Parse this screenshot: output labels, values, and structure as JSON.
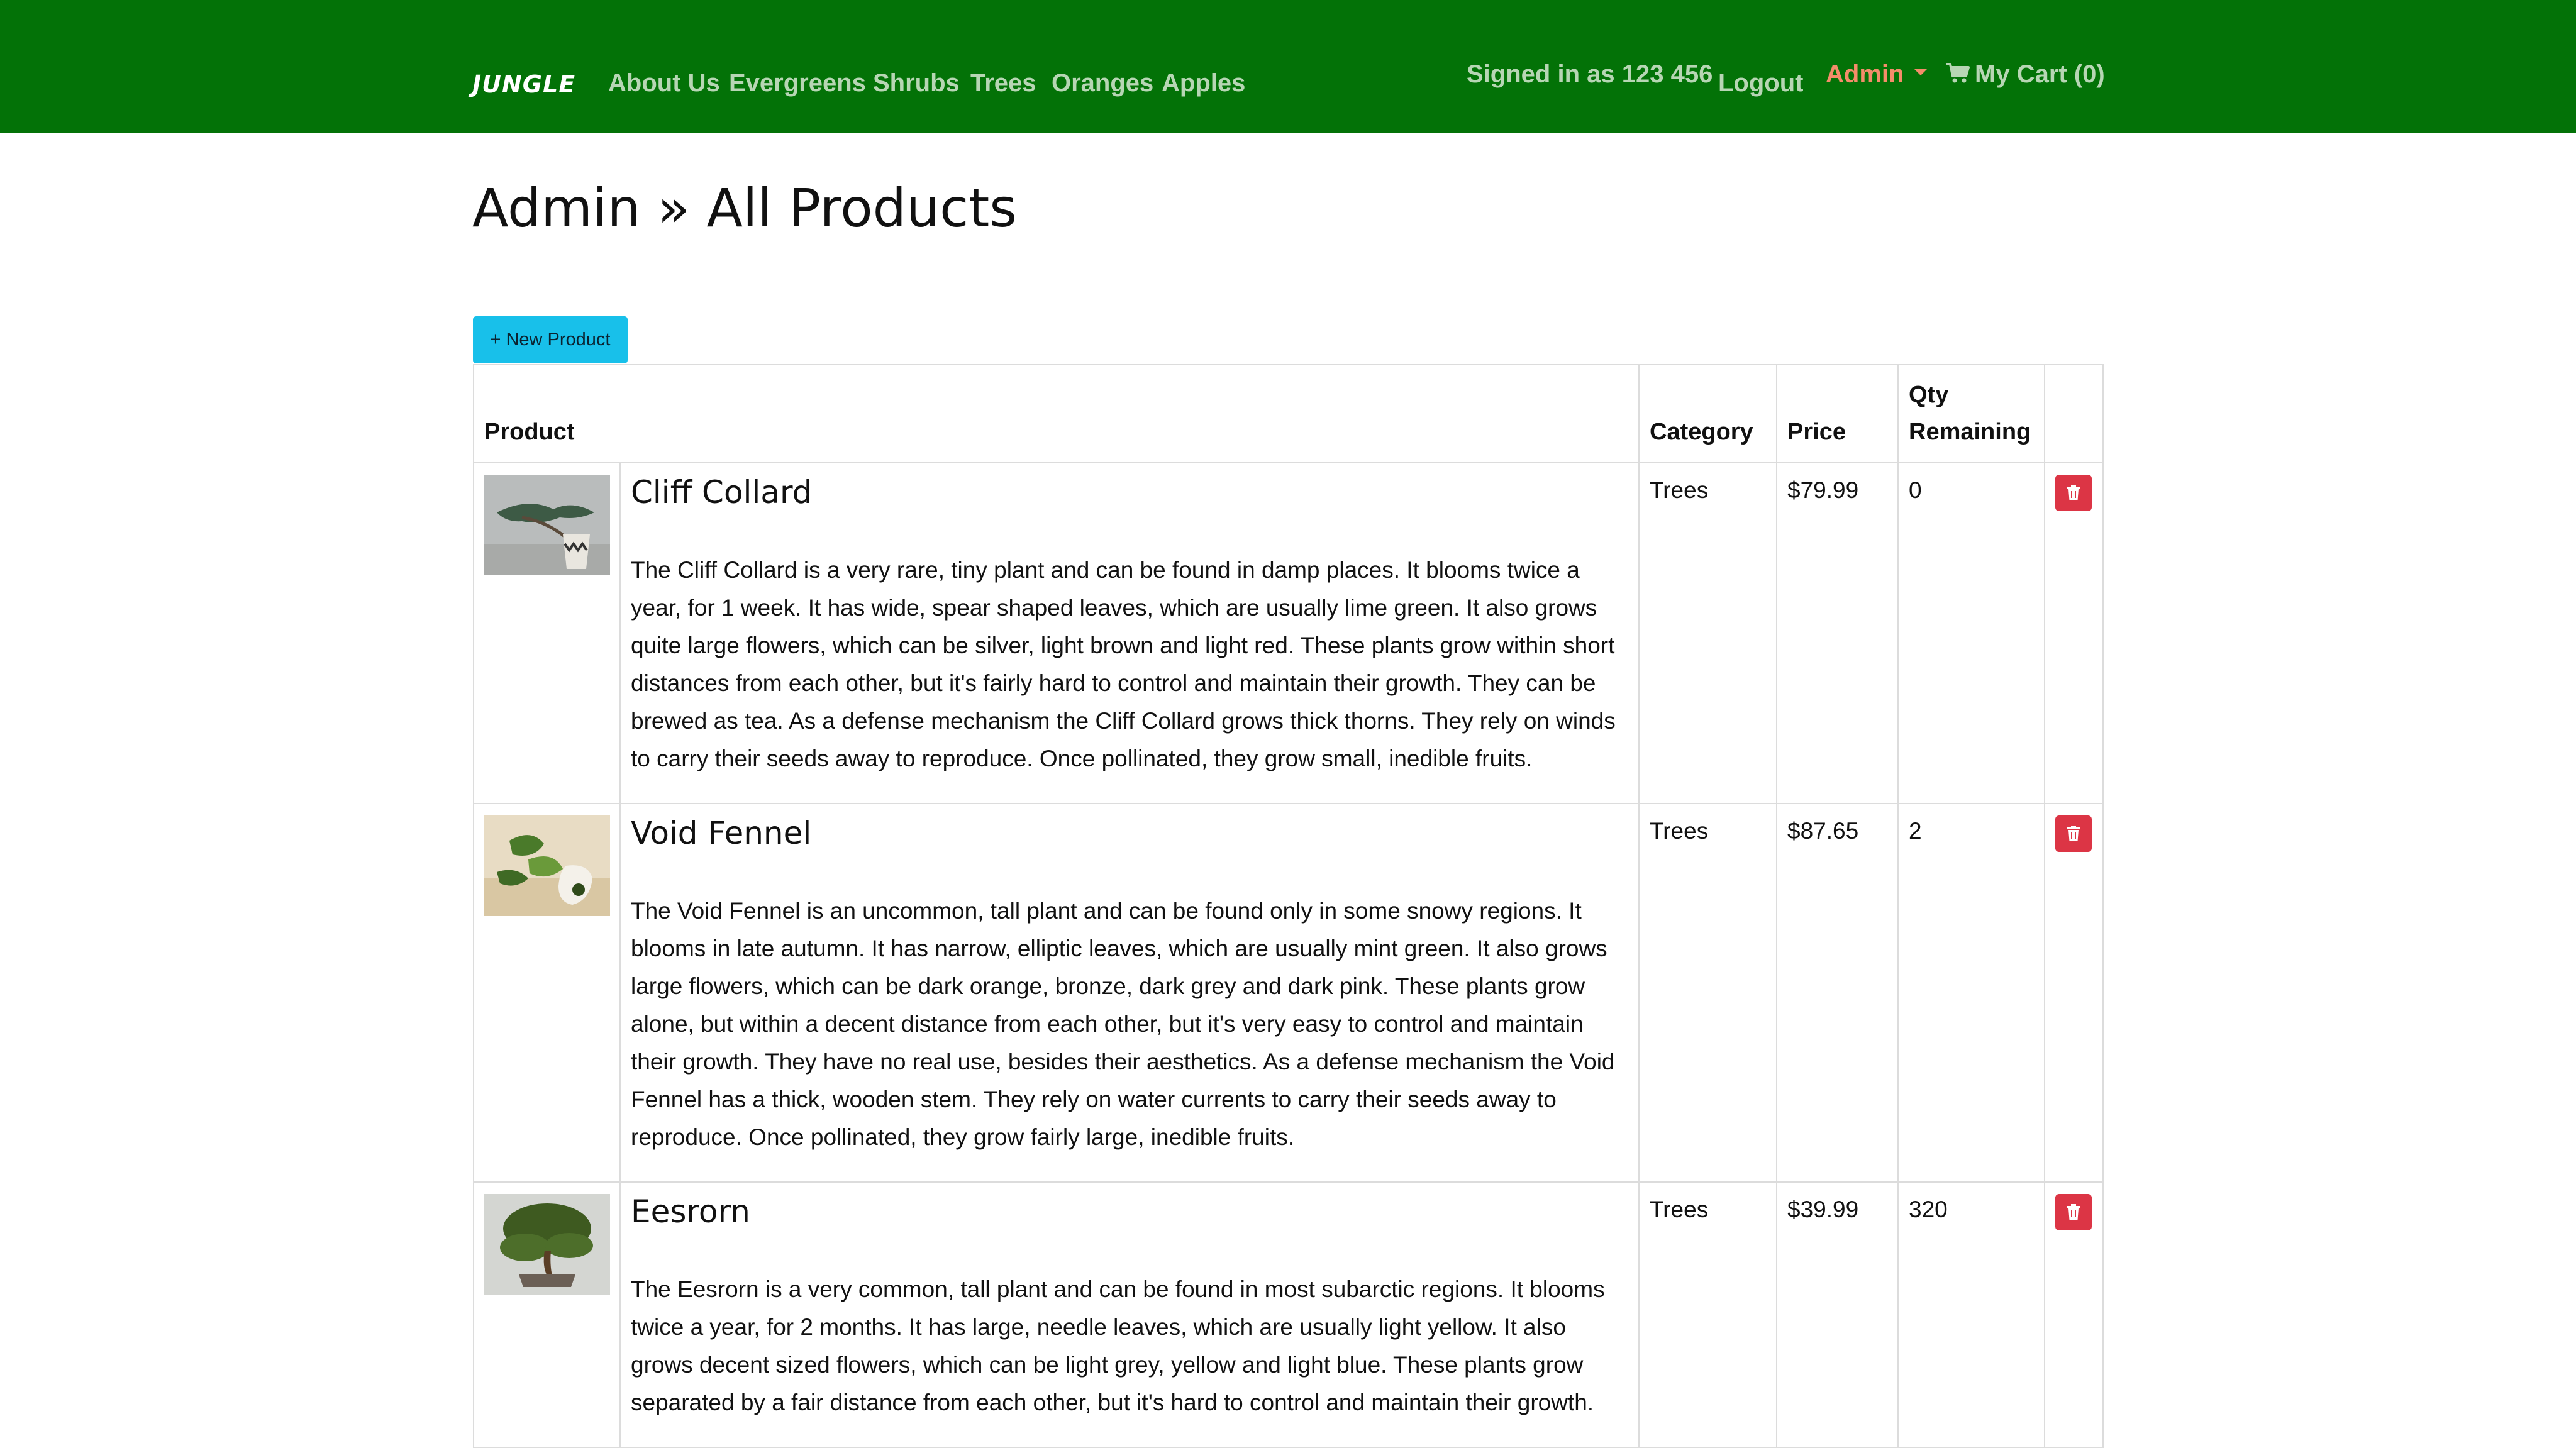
{
  "nav": {
    "brand": "JUNGLE",
    "links": [
      "About Us",
      "Evergreens",
      "Shrubs",
      "Trees",
      "Oranges",
      "Apples"
    ],
    "signed_in": "Signed in as 123 456",
    "logout": "Logout",
    "admin": "Admin",
    "cart": "My Cart (0)",
    "colors": {
      "bar": "#037207",
      "link": "#b7d6b4",
      "admin": "#f48d6a"
    }
  },
  "page": {
    "title": "Admin » All Products",
    "new_product_button": "+ New Product"
  },
  "table": {
    "headers": {
      "product": "Product",
      "category": "Category",
      "price": "Price",
      "qty": "Qty Remaining"
    },
    "rows": [
      {
        "name": "Cliff Collard",
        "description": "The Cliff Collard is a very rare, tiny plant and can be found in damp places. It blooms twice a year, for 1 week. It has wide, spear shaped leaves, which are usually lime green. It also grows quite large flowers, which can be silver, light brown and light red. These plants grow within short distances from each other, but it's fairly hard to control and maintain their growth. They can be brewed as tea. As a defense mechanism the Cliff Collard grows thick thorns. They rely on winds to carry their seeds away to reproduce. Once pollinated, they grow small, inedible fruits.",
        "category": "Trees",
        "price": "$79.99",
        "qty": "0",
        "image_icon": "bonsai-pine-photo"
      },
      {
        "name": "Void Fennel",
        "description": "The Void Fennel is an uncommon, tall plant and can be found only in some snowy regions. It blooms in late autumn. It has narrow, elliptic leaves, which are usually mint green. It also grows large flowers, which can be dark orange, bronze, dark grey and dark pink. These plants grow alone, but within a decent distance from each other, but it's very easy to control and maintain their growth. They have no real use, besides their aesthetics. As a defense mechanism the Void Fennel has a thick, wooden stem. They rely on water currents to carry their seeds away to reproduce. Once pollinated, they grow fairly large, inedible fruits.",
        "category": "Trees",
        "price": "$87.65",
        "qty": "2",
        "image_icon": "pothos-photo"
      },
      {
        "name": "Eesrorn",
        "description": "The Eesrorn is a very common, tall plant and can be found in most subarctic regions. It blooms twice a year, for 2 months. It has large, needle leaves, which are usually light yellow. It also grows decent sized flowers, which can be light grey, yellow and light blue. These plants grow separated by a fair distance from each other, but it's hard to control and maintain their growth.",
        "category": "Trees",
        "price": "$39.99",
        "qty": "320",
        "image_icon": "bonsai-tree-photo"
      }
    ]
  }
}
